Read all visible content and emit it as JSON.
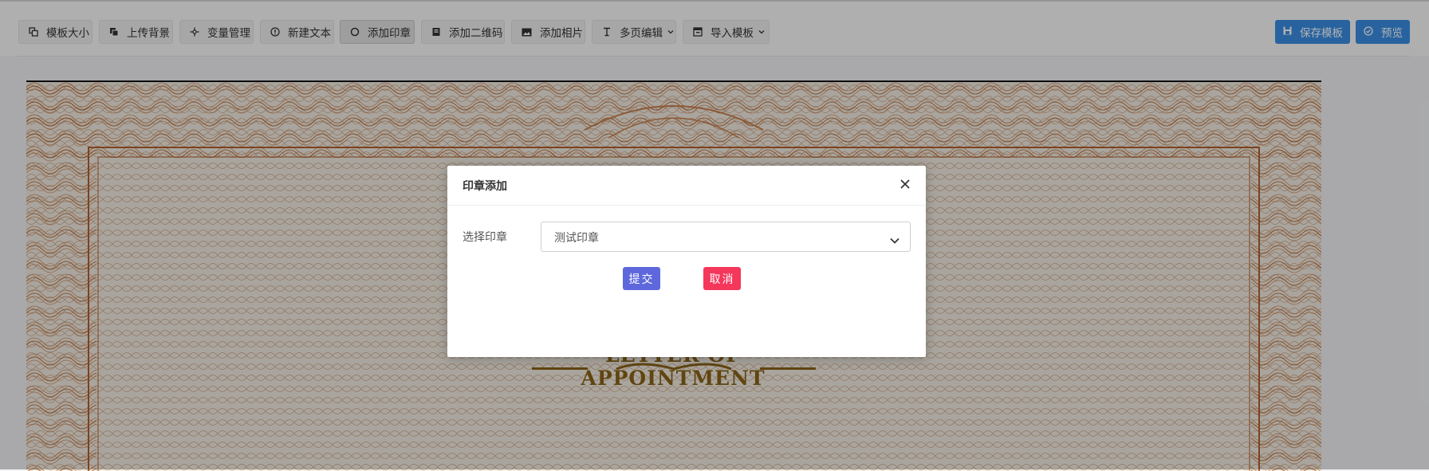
{
  "toolbar": {
    "buttons": [
      {
        "label": "模板大小",
        "icon": "copy-icon"
      },
      {
        "label": "上传背景",
        "icon": "upload-image-icon"
      },
      {
        "label": "变量管理",
        "icon": "move-icon"
      },
      {
        "label": "新建文本",
        "icon": "info-circle-icon"
      },
      {
        "label": "添加印章",
        "icon": "circle-icon"
      },
      {
        "label": "添加二维码",
        "icon": "qrcode-icon"
      },
      {
        "label": "添加相片",
        "icon": "image-icon"
      },
      {
        "label": "多页编辑",
        "icon": "text-cursor-icon"
      },
      {
        "label": "导入模板",
        "icon": "import-icon"
      }
    ],
    "save_label": "保存模板",
    "preview_label": "预览"
  },
  "certificate": {
    "title": "LETTER OF APPOINTMENT"
  },
  "modal": {
    "title": "印章添加",
    "field_label": "选择印章",
    "selected_seal": "测试印章",
    "submit_label": "提交",
    "cancel_label": "取消"
  },
  "colors": {
    "primary_blue": "#3a8ee6",
    "submit": "#5e68dc",
    "cancel": "#f4375b",
    "certificate_ornament": "#c0723e"
  }
}
